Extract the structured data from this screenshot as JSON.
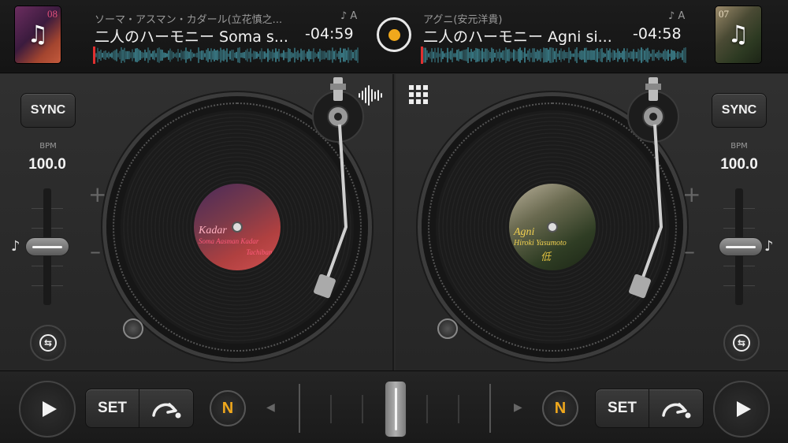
{
  "deck_a": {
    "number": "08",
    "artist": "ソーマ・アスマン・カダール(立花慎之...",
    "key": "♪ A",
    "title": "二人のハーモニー Soma s...",
    "time": "-04:59",
    "sync_label": "SYNC",
    "bpm_label": "BPM",
    "bpm": "100.0",
    "plus": "+",
    "minus": "–",
    "label_text_1": "Kadar",
    "label_text_2": "Soma Aasman Kadar",
    "label_text_3": "Tachibana"
  },
  "deck_b": {
    "number": "07",
    "artist": "アグニ(安元洋貴)",
    "key": "♪ A",
    "title": "二人のハーモニー Agni si...",
    "time": "-04:58",
    "sync_label": "SYNC",
    "bpm_label": "BPM",
    "bpm": "100.0",
    "plus": "+",
    "minus": "–",
    "label_text_1": "Agni",
    "label_text_2": "Hiroki Yasumoto",
    "label_text_3": "低"
  },
  "bottom": {
    "set_label_a": "SET",
    "set_label_b": "SET",
    "n_label_a": "N",
    "n_label_b": "N"
  },
  "icons": {
    "album_art": "music-note-icon",
    "waveform_view": "waveform-icon",
    "grid_view": "grid-icon",
    "keylock": "keylock-icon",
    "play": "play-icon",
    "cue_jump": "cue-jump-icon"
  },
  "colors": {
    "accent": "#f0a81c",
    "waveform": "#4fb6c8",
    "playhead": "#e03030"
  },
  "crossfader": {
    "position": 0.5
  },
  "pitch": {
    "deck_a": 0.5,
    "deck_b": 0.5
  }
}
